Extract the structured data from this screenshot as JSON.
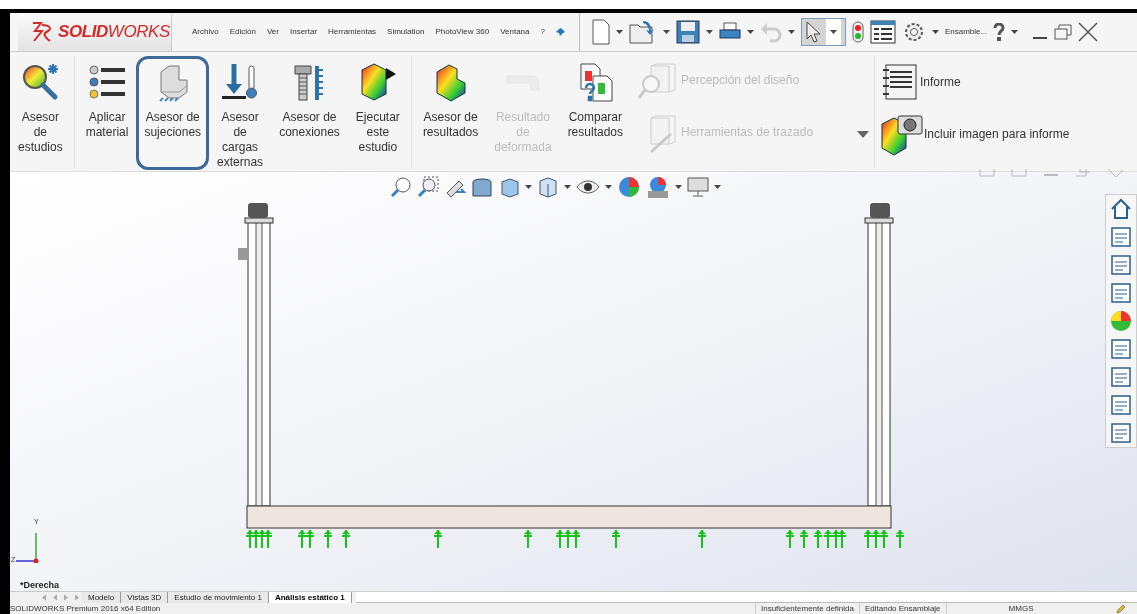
{
  "title_bar": {
    "logo": "**SOLID**WORKS",
    "menu": [
      "Archivo",
      "Edición",
      "Ver",
      "Insertar",
      "Herramientas",
      "Simulation",
      "PhotoView 360",
      "Ventana",
      "?"
    ],
    "document": "Ensamble..."
  },
  "ribbon": {
    "large_buttons": [
      {
        "label": "Asesor\nde\nestudios",
        "disabled": false,
        "highlighted": false
      },
      {
        "label": "Aplicar\nmaterial",
        "disabled": false,
        "highlighted": false
      },
      {
        "label": "Asesor de\nsujeciones",
        "disabled": false,
        "highlighted": true
      },
      {
        "label": "Asesor\nde\ncargas\nexternas",
        "disabled": false,
        "highlighted": false
      },
      {
        "label": "Asesor de\nconexiones",
        "disabled": false,
        "highlighted": false
      },
      {
        "label": "Ejecutar\neste\nestudio",
        "disabled": false,
        "highlighted": false
      },
      {
        "label": "Asesor de\nresultados",
        "disabled": false,
        "highlighted": false
      },
      {
        "label": "Resultado\nde\ndeformada",
        "disabled": true,
        "highlighted": false
      },
      {
        "label": "Comparar\nresultados",
        "disabled": false,
        "highlighted": false
      }
    ],
    "small_buttons": [
      {
        "label": "Percepción del diseño",
        "disabled": true
      },
      {
        "label": "Herramientas de trazado",
        "disabled": true
      }
    ],
    "report_buttons": [
      {
        "label": "Informe",
        "disabled": false
      },
      {
        "label": "Incluir imagen para informe",
        "disabled": false
      }
    ]
  },
  "viewport": {
    "view_name": "*Derecha",
    "triad": [
      "Y",
      "Z"
    ]
  },
  "tabs": [
    {
      "label": "Modelo",
      "selected": false
    },
    {
      "label": "Vistas 3D",
      "selected": false
    },
    {
      "label": "Estudio de movimiento 1",
      "selected": false
    },
    {
      "label": "Análisis estático 1",
      "selected": true
    }
  ],
  "status_bar": {
    "product": "SOLIDWORKS Premium 2016 x64 Edition",
    "fields": [
      "Insuficientemente definida",
      "Editando Ensamblaje",
      "MMGS"
    ]
  }
}
